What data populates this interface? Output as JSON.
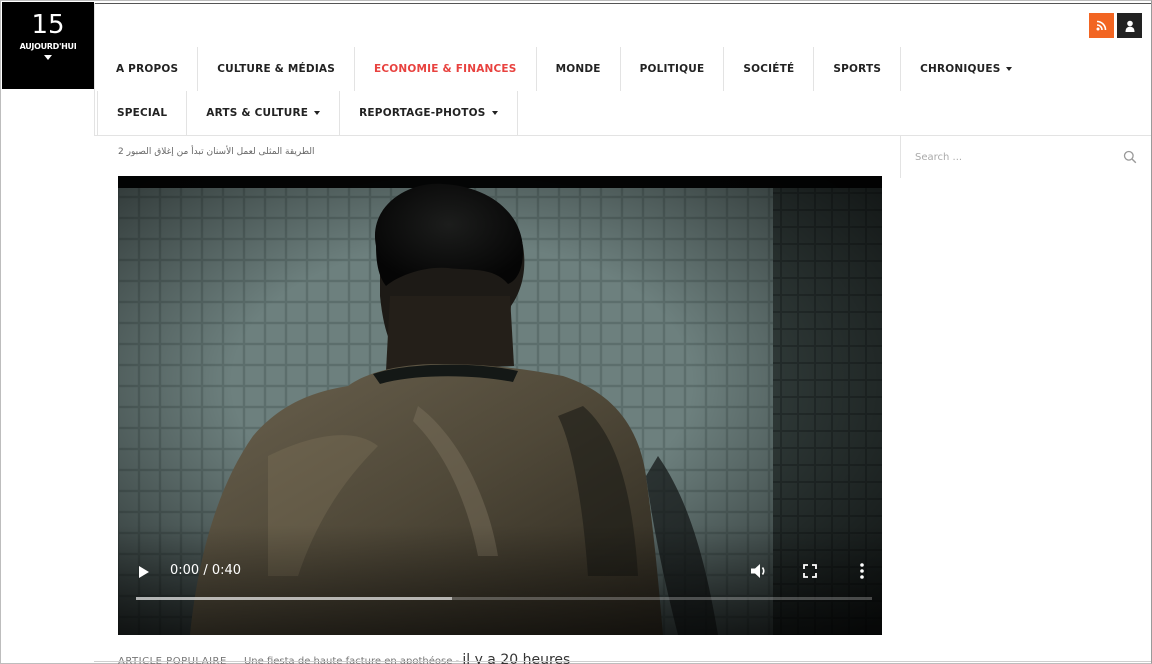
{
  "date": {
    "day": "15",
    "label": "AUJOURD'HUI"
  },
  "icons": {
    "rss": "rss-icon",
    "user": "user-icon",
    "accent_rss": "#f26522"
  },
  "nav": {
    "row1": [
      {
        "label": "A PROPOS"
      },
      {
        "label": "CULTURE & MÉDIAS"
      },
      {
        "label": "ECONOMIE & FINANCES",
        "active": true
      },
      {
        "label": "MONDE"
      },
      {
        "label": "POLITIQUE"
      },
      {
        "label": "SOCIÉTÉ"
      },
      {
        "label": "SPORTS"
      },
      {
        "label": "CHRONIQUES",
        "dropdown": true
      }
    ],
    "row2": [
      {
        "label": "SPECIAL"
      },
      {
        "label": "ARTS & CULTURE",
        "dropdown": true
      },
      {
        "label": "REPORTAGE-PHOTOS",
        "dropdown": true
      }
    ],
    "active_color": "#e8423f"
  },
  "ticker": {
    "text": "الطريقة المثلى لعمل الأسنان تبدأ من إغلاق الصبور 2"
  },
  "search": {
    "placeholder": "Search ..."
  },
  "video": {
    "current_time": "0:00",
    "duration": "0:40",
    "time_display": "0:00 / 0:40",
    "buffered_fraction": 0.43
  },
  "popular": {
    "label": "ARTICLE POPULAIRE",
    "title": "Une fiesta de haute facture en apothéose -",
    "time": "il y a 20 heures"
  }
}
